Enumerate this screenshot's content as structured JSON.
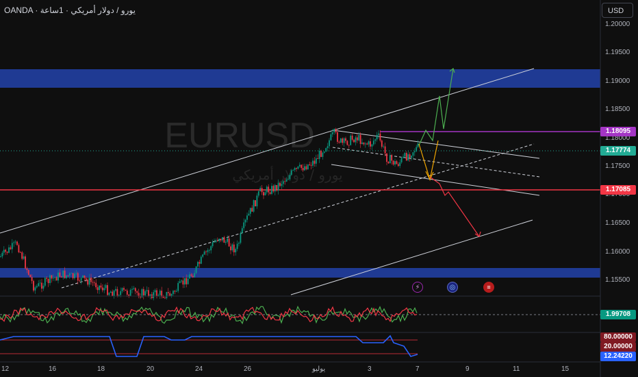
{
  "header": {
    "title": "OANDA · يورو / دولار أمريكي · 1ساعة",
    "currency_button": "USD"
  },
  "watermark": {
    "symbol": "EURUSD",
    "name": "يورو / دولار أمريكي"
  },
  "price_axis": {
    "labels": [
      "1.20000",
      "1.19500",
      "1.19000",
      "1.18500",
      "1.18000",
      "1.17500",
      "1.17000",
      "1.16500",
      "1.16000",
      "1.15500"
    ]
  },
  "price_tags": {
    "resistance": "1.18095",
    "current": "1.17774",
    "support": "1.17085",
    "oscillator": "1.99708",
    "rsi_upper": "80.00000",
    "rsi_lower": "20.00000",
    "rsi_value": "12.24220"
  },
  "time_axis": {
    "labels": [
      "12",
      "16",
      "18",
      "20",
      "24",
      "26",
      "يوليو",
      "3",
      "7",
      "9",
      "11",
      "15"
    ]
  },
  "events": [
    "lightning-icon",
    "globe-icon",
    "us-flag-icon"
  ],
  "colors": {
    "background": "#0f0f0f",
    "zone": "#1f3a93",
    "resistance": "#a335c4",
    "current": "#22ab94",
    "support": "#f23645",
    "bull": "#089981",
    "bear": "#f23645"
  }
}
